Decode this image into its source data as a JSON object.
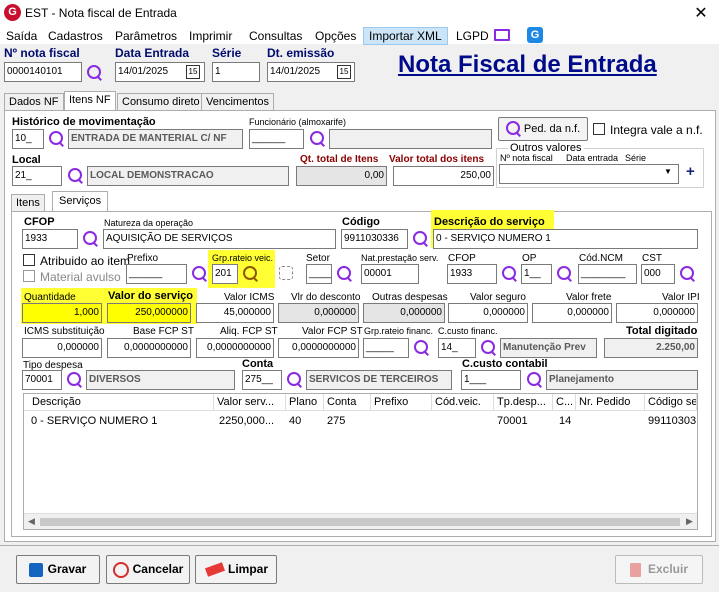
{
  "window": {
    "title": "EST - Nota fiscal de Entrada",
    "close": "✕",
    "app_icon": "G"
  },
  "menu": [
    "Saída",
    "Cadastros",
    "Parâmetros",
    "Imprimir",
    "Consultas",
    "Opções",
    "Importar XML",
    "LGPD"
  ],
  "header": {
    "nota_label": "Nº nota fiscal",
    "nota_value": "0000140101",
    "data_entrada_label": "Data Entrada",
    "data_entrada_value": "14/01/2025",
    "serie_label": "Série",
    "serie_value": "1",
    "dt_emissao_label": "Dt. emissão",
    "dt_emissao_value": "14/01/2025",
    "page_title": "Nota Fiscal de Entrada",
    "cal": "15"
  },
  "tabs": [
    "Dados NF",
    "Itens NF",
    "Consumo direto",
    "Vencimentos"
  ],
  "itens": {
    "historico_label": "Histórico de movimentação",
    "historico_code": "10_",
    "historico_desc": "ENTRADA DE MANTERIAL C/ NF",
    "funcionario_label": "Funcionário (almoxarife)",
    "funcionario_code": "______",
    "ped_button": "Ped. da n.f.",
    "integra_label": "Integra vale a n.f.",
    "local_label": "Local",
    "local_code": "21_",
    "local_desc": "LOCAL DEMONSTRACAO",
    "qt_total_label": "Qt. total de Itens",
    "qt_total_value": "0,00",
    "valor_total_label": "Valor total dos itens",
    "valor_total_value": "250,00",
    "outros_label": "Outros valores",
    "outros_cols": [
      "Nº nota fiscal",
      "Data entrada",
      "Série"
    ],
    "outros_plus": "+"
  },
  "subtabs": [
    "Itens",
    "Serviços"
  ],
  "servicos": {
    "cfop_label": "CFOP",
    "cfop_value": "1933",
    "natureza_label": "Natureza da operação",
    "natureza_value": "AQUISIÇÃO DE SERVIÇOS",
    "codigo_label": "Código",
    "codigo_value": "9911030336",
    "descricao_label": "Descrição do serviço",
    "descricao_value": "0 - SERVIÇO NUMERO 1",
    "atribuido_label": "Atribuido ao item",
    "material_label": "Material avulso",
    "prefixo_label": "Prefixo",
    "prefixo_value": "______",
    "grp_label": "Grp.rateio veic.",
    "grp_value": "201",
    "setor_label": "Setor",
    "setor_value": "____",
    "natprest_label": "Nat.prestação serv.",
    "natprest_value": "00001",
    "cfop2_label": "CFOP",
    "cfop2_value": "1933",
    "op_label": "OP",
    "op_value": "1__",
    "codncm_label": "Cód.NCM",
    "codncm_value": "________",
    "cst_label": "CST",
    "cst_value": "000",
    "quantidade_label": "Quantidade",
    "quantidade_value": "1,000",
    "valor_servico_label": "Valor do serviço",
    "valor_servico_value": "250,000000",
    "valor_icms_label": "Valor ICMS",
    "valor_icms_value": "45,000000",
    "vlr_desconto_label": "Vlr do desconto",
    "vlr_desconto_value": "0,000000",
    "outras_label": "Outras despesas",
    "outras_value": "0,000000",
    "seguro_label": "Valor seguro",
    "seguro_value": "0,000000",
    "frete_label": "Valor frete",
    "frete_value": "0,000000",
    "ipi_label": "Valor IPI",
    "ipi_value": "0,000000",
    "icms_sub_label": "ICMS substituição",
    "icms_sub_value": "0,000000",
    "base_fcp_label": "Base FCP ST",
    "base_fcp_value": "0,0000000000",
    "aliq_fcp_label": "Aliq. FCP ST",
    "aliq_fcp_value": "0,0000000000",
    "valor_fcp_label": "Valor FCP ST",
    "valor_fcp_value": "0,0000000000",
    "grp_financ_label": "Grp.rateio financ.",
    "grp_financ_value": "_____",
    "ccusto_fin_label": "C.custo financ.",
    "ccusto_fin_code": "14_",
    "ccusto_fin_desc": "Manutenção Prev",
    "total_digitado_label": "Total digitado",
    "total_digitado_value": "2.250,00",
    "tipo_despesa_label": "Tipo despesa",
    "tipo_despesa_code": "70001",
    "tipo_despesa_desc": "DIVERSOS",
    "conta_label": "Conta",
    "conta_code": "275__",
    "conta_desc": "SERVICOS DE TERCEIROS",
    "ccusto_cont_label": "C.custo contabil",
    "ccusto_cont_code": "1___",
    "ccusto_cont_desc": "Planejamento"
  },
  "grid": {
    "columns": [
      "Descrição",
      "Valor serv...",
      "Plano",
      "Conta",
      "Prefixo",
      "Cód.veic.",
      "Tp.desp...",
      "C...",
      "Nr. Pedido",
      "Código ser"
    ],
    "rows": [
      [
        "0 - SERVIÇO NUMERO 1",
        "2250,000...",
        "40",
        "275",
        "",
        "",
        "70001",
        "14",
        "",
        "99110303"
      ]
    ]
  },
  "footer": {
    "gravar": "Gravar",
    "cancelar": "Cancelar",
    "limpar": "Limpar",
    "excluir": "Excluir"
  }
}
